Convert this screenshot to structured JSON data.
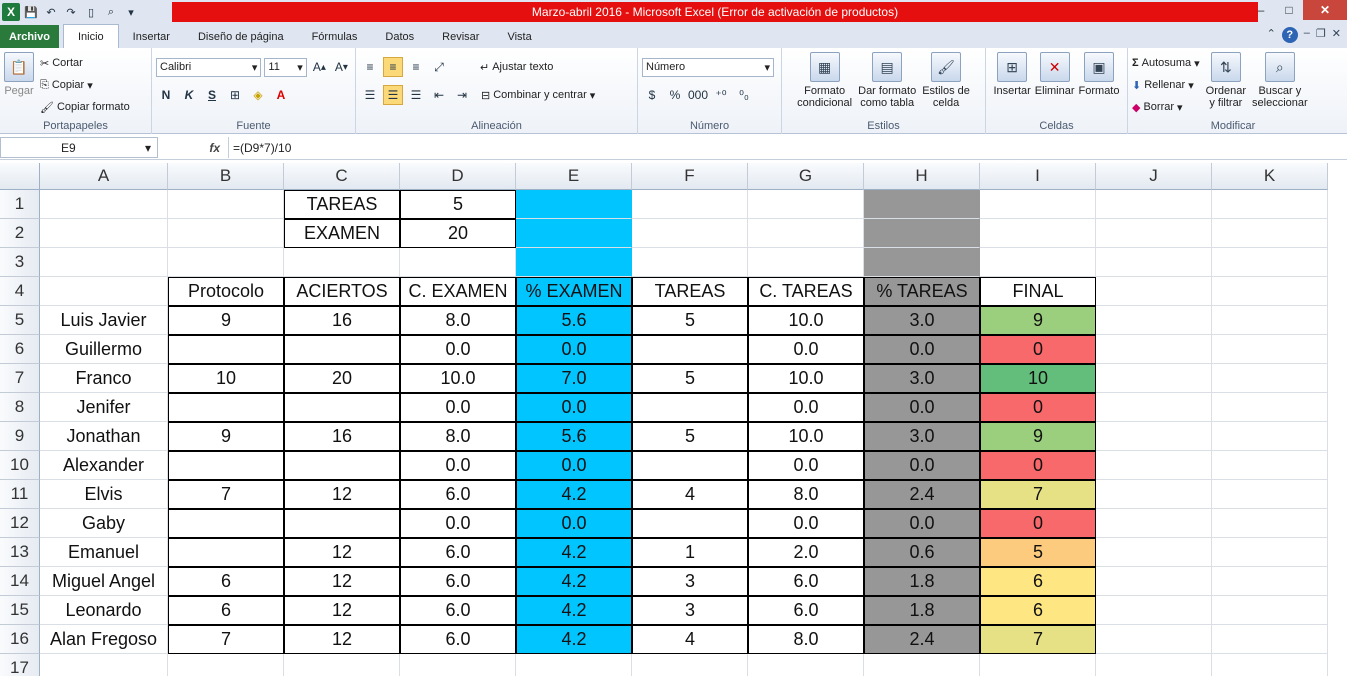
{
  "window": {
    "title": "Marzo-abril 2016  -  Microsoft Excel (Error de activación de productos)",
    "controls": [
      "–",
      "□",
      "✕"
    ]
  },
  "tabs": [
    {
      "label": "Archivo",
      "type": "file"
    },
    {
      "label": "Inicio",
      "type": "active"
    },
    {
      "label": "Insertar"
    },
    {
      "label": "Diseño de página"
    },
    {
      "label": "Fórmulas"
    },
    {
      "label": "Datos"
    },
    {
      "label": "Revisar"
    },
    {
      "label": "Vista"
    }
  ],
  "ribbon": {
    "clipboard": {
      "paste": "Pegar",
      "cut": "Cortar",
      "copy": "Copiar",
      "format_painter": "Copiar formato",
      "label": "Portapapeles"
    },
    "font": {
      "name": "Calibri",
      "size": "11",
      "bold": "N",
      "italic": "K",
      "underline": "S",
      "label": "Fuente"
    },
    "alignment": {
      "wrap": "Ajustar texto",
      "merge": "Combinar y centrar",
      "label": "Alineación"
    },
    "number": {
      "format": "Número",
      "currency": "$",
      "percent": "%",
      "thousands": "000",
      "label": "Número"
    },
    "styles": {
      "conditional": [
        "Formato",
        "condicional"
      ],
      "table": [
        "Dar formato",
        "como tabla"
      ],
      "cell_styles": [
        "Estilos de",
        "celda"
      ],
      "label": "Estilos"
    },
    "cells": {
      "insert": "Insertar",
      "delete": "Eliminar",
      "format": "Formato",
      "label": "Celdas"
    },
    "editing": {
      "autosum": "Autosuma",
      "fill": "Rellenar",
      "clear": "Borrar",
      "sort": [
        "Ordenar",
        "y filtrar"
      ],
      "find": [
        "Buscar y",
        "seleccionar"
      ],
      "label": "Modificar"
    }
  },
  "formula_bar": {
    "cell_ref": "E9",
    "fx": "fx",
    "formula": "=(D9*7)/10"
  },
  "columns": [
    "A",
    "B",
    "C",
    "D",
    "E",
    "F",
    "G",
    "H",
    "I",
    "J",
    "K"
  ],
  "rows": [
    "1",
    "2",
    "3",
    "4",
    "5",
    "6",
    "7",
    "8",
    "9",
    "10",
    "11",
    "12",
    "13",
    "14",
    "15",
    "16",
    "17"
  ],
  "colors": {
    "cyan": "#00c5ff",
    "gray": "#979797",
    "red": "#f8696b",
    "green_dark": "#63be7b",
    "green_light": "#9bcf7e",
    "yellow": "#e6e184",
    "orange": "#fdcb7e",
    "yellow2": "#fee783"
  },
  "summary": {
    "tareas_label": "TAREAS",
    "tareas_value": "5",
    "examen_label": "EXAMEN",
    "examen_value": "20"
  },
  "headers": [
    "Protocolo",
    "ACIERTOS",
    "C. EXAMEN",
    "% EXAMEN",
    "TAREAS",
    "C. TAREAS",
    "% TAREAS",
    "FINAL"
  ],
  "students": [
    {
      "name": "Luis Javier",
      "protocolo": "9",
      "aciertos": "16",
      "c_examen": "8.0",
      "p_examen": "5.6",
      "tareas": "5",
      "c_tareas": "10.0",
      "p_tareas": "3.0",
      "final": "9",
      "final_color": "#9bcf7e"
    },
    {
      "name": "Guillermo",
      "protocolo": "",
      "aciertos": "",
      "c_examen": "0.0",
      "p_examen": "0.0",
      "tareas": "",
      "c_tareas": "0.0",
      "p_tareas": "0.0",
      "final": "0",
      "final_color": "#f8696b"
    },
    {
      "name": "Franco",
      "protocolo": "10",
      "aciertos": "20",
      "c_examen": "10.0",
      "p_examen": "7.0",
      "tareas": "5",
      "c_tareas": "10.0",
      "p_tareas": "3.0",
      "final": "10",
      "final_color": "#63be7b"
    },
    {
      "name": "Jenifer",
      "protocolo": "",
      "aciertos": "",
      "c_examen": "0.0",
      "p_examen": "0.0",
      "tareas": "",
      "c_tareas": "0.0",
      "p_tareas": "0.0",
      "final": "0",
      "final_color": "#f8696b"
    },
    {
      "name": "Jonathan",
      "protocolo": "9",
      "aciertos": "16",
      "c_examen": "8.0",
      "p_examen": "5.6",
      "tareas": "5",
      "c_tareas": "10.0",
      "p_tareas": "3.0",
      "final": "9",
      "final_color": "#9bcf7e"
    },
    {
      "name": "Alexander",
      "protocolo": "",
      "aciertos": "",
      "c_examen": "0.0",
      "p_examen": "0.0",
      "tareas": "",
      "c_tareas": "0.0",
      "p_tareas": "0.0",
      "final": "0",
      "final_color": "#f8696b"
    },
    {
      "name": "Elvis",
      "protocolo": "7",
      "aciertos": "12",
      "c_examen": "6.0",
      "p_examen": "4.2",
      "tareas": "4",
      "c_tareas": "8.0",
      "p_tareas": "2.4",
      "final": "7",
      "final_color": "#e6e184"
    },
    {
      "name": "Gaby",
      "protocolo": "",
      "aciertos": "",
      "c_examen": "0.0",
      "p_examen": "0.0",
      "tareas": "",
      "c_tareas": "0.0",
      "p_tareas": "0.0",
      "final": "0",
      "final_color": "#f8696b"
    },
    {
      "name": "Emanuel",
      "protocolo": "",
      "aciertos": "12",
      "c_examen": "6.0",
      "p_examen": "4.2",
      "tareas": "1",
      "c_tareas": "2.0",
      "p_tareas": "0.6",
      "final": "5",
      "final_color": "#fdcb7e"
    },
    {
      "name": "Miguel Angel",
      "protocolo": "6",
      "aciertos": "12",
      "c_examen": "6.0",
      "p_examen": "4.2",
      "tareas": "3",
      "c_tareas": "6.0",
      "p_tareas": "1.8",
      "final": "6",
      "final_color": "#fee783"
    },
    {
      "name": "Leonardo",
      "protocolo": "6",
      "aciertos": "12",
      "c_examen": "6.0",
      "p_examen": "4.2",
      "tareas": "3",
      "c_tareas": "6.0",
      "p_tareas": "1.8",
      "final": "6",
      "final_color": "#fee783"
    },
    {
      "name": "Alan Fregoso",
      "protocolo": "7",
      "aciertos": "12",
      "c_examen": "6.0",
      "p_examen": "4.2",
      "tareas": "4",
      "c_tareas": "8.0",
      "p_tareas": "2.4",
      "final": "7",
      "final_color": "#e6e184"
    }
  ]
}
